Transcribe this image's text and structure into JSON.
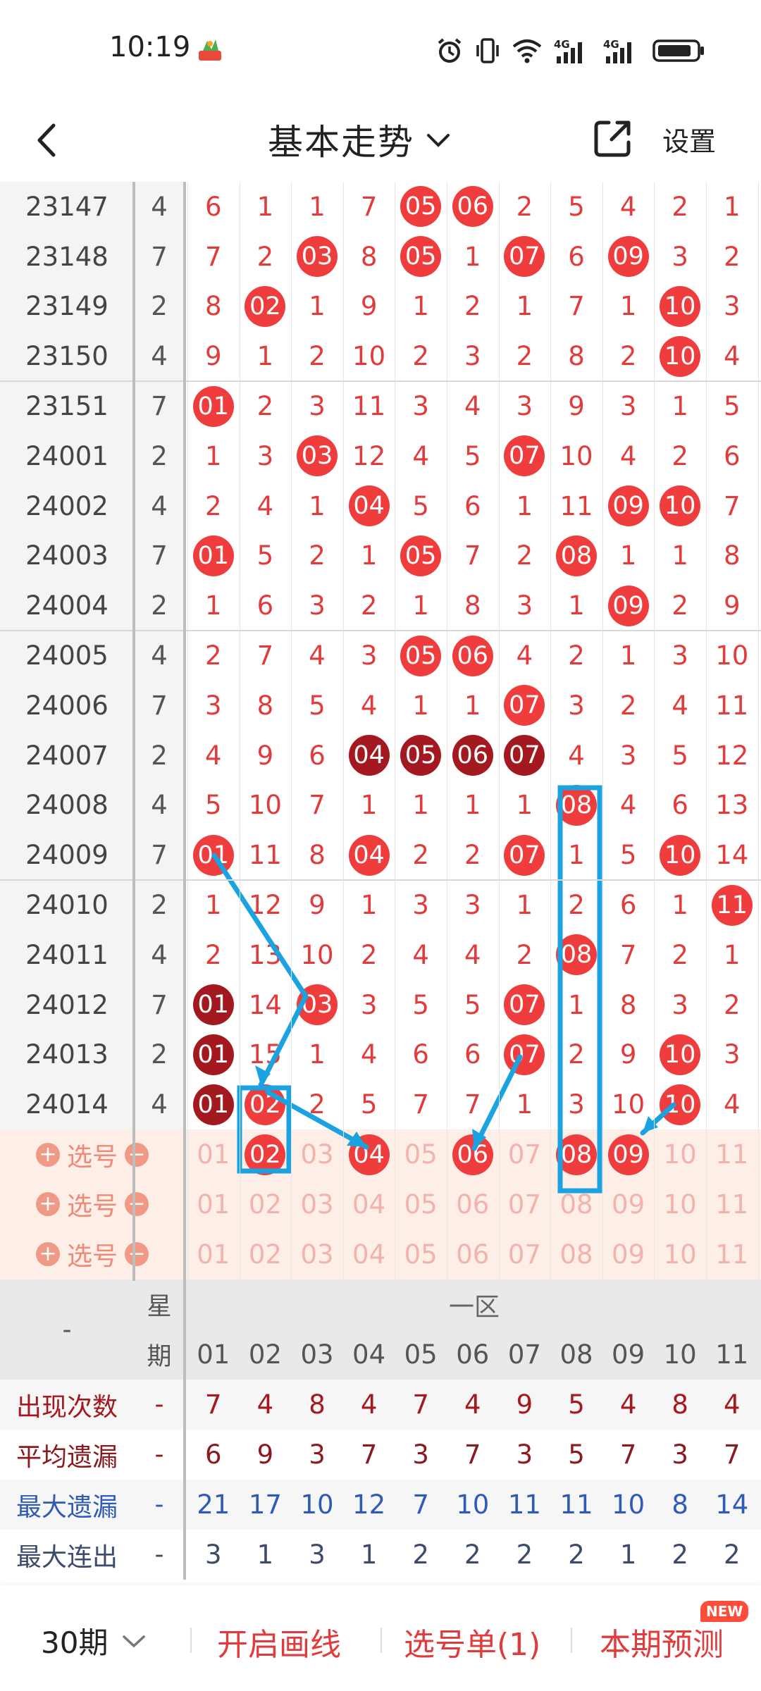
{
  "status_bar": {
    "time": "10:19",
    "net1": "4G",
    "net2": "4G"
  },
  "header": {
    "title": "基本走势",
    "settings": "设置"
  },
  "columns": [
    "01",
    "02",
    "03",
    "04",
    "05",
    "06",
    "07",
    "08",
    "09",
    "10",
    "11"
  ],
  "rows": [
    {
      "issue": "23147",
      "week": "4",
      "cells": [
        "6",
        "1",
        "1",
        "7",
        "05",
        "06",
        "2",
        "5",
        "4",
        "2",
        "1"
      ],
      "balls": [
        4,
        5
      ],
      "dark": []
    },
    {
      "issue": "23148",
      "week": "7",
      "cells": [
        "7",
        "2",
        "03",
        "8",
        "05",
        "1",
        "07",
        "6",
        "09",
        "3",
        "2"
      ],
      "balls": [
        2,
        4,
        6,
        8
      ],
      "dark": []
    },
    {
      "issue": "23149",
      "week": "2",
      "cells": [
        "8",
        "02",
        "1",
        "9",
        "1",
        "2",
        "1",
        "7",
        "1",
        "10",
        "3"
      ],
      "balls": [
        1,
        9
      ],
      "dark": []
    },
    {
      "issue": "23150",
      "week": "4",
      "cells": [
        "9",
        "1",
        "2",
        "10",
        "2",
        "3",
        "2",
        "8",
        "2",
        "10",
        "4"
      ],
      "balls": [
        9
      ],
      "dark": []
    },
    {
      "issue": "23151",
      "week": "7",
      "cells": [
        "01",
        "2",
        "3",
        "11",
        "3",
        "4",
        "3",
        "9",
        "3",
        "1",
        "5"
      ],
      "balls": [
        0
      ],
      "dark": []
    },
    {
      "issue": "24001",
      "week": "2",
      "cells": [
        "1",
        "3",
        "03",
        "12",
        "4",
        "5",
        "07",
        "10",
        "4",
        "2",
        "6"
      ],
      "balls": [
        2,
        6
      ],
      "dark": []
    },
    {
      "issue": "24002",
      "week": "4",
      "cells": [
        "2",
        "4",
        "1",
        "04",
        "5",
        "6",
        "1",
        "11",
        "09",
        "10",
        "7"
      ],
      "balls": [
        3,
        8,
        9
      ],
      "dark": []
    },
    {
      "issue": "24003",
      "week": "7",
      "cells": [
        "01",
        "5",
        "2",
        "1",
        "05",
        "7",
        "2",
        "08",
        "1",
        "1",
        "8"
      ],
      "balls": [
        0,
        4,
        7
      ],
      "dark": []
    },
    {
      "issue": "24004",
      "week": "2",
      "cells": [
        "1",
        "6",
        "3",
        "2",
        "1",
        "8",
        "3",
        "1",
        "09",
        "2",
        "9"
      ],
      "balls": [
        8
      ],
      "dark": []
    },
    {
      "issue": "24005",
      "week": "4",
      "cells": [
        "2",
        "7",
        "4",
        "3",
        "05",
        "06",
        "4",
        "2",
        "1",
        "3",
        "10"
      ],
      "balls": [
        4,
        5
      ],
      "dark": []
    },
    {
      "issue": "24006",
      "week": "7",
      "cells": [
        "3",
        "8",
        "5",
        "4",
        "1",
        "1",
        "07",
        "3",
        "2",
        "4",
        "11"
      ],
      "balls": [
        6
      ],
      "dark": []
    },
    {
      "issue": "24007",
      "week": "2",
      "cells": [
        "4",
        "9",
        "6",
        "04",
        "05",
        "06",
        "07",
        "4",
        "3",
        "5",
        "12"
      ],
      "balls": [
        3,
        4,
        5,
        6
      ],
      "dark": [
        3,
        4,
        5,
        6
      ]
    },
    {
      "issue": "24008",
      "week": "4",
      "cells": [
        "5",
        "10",
        "7",
        "1",
        "1",
        "1",
        "1",
        "08",
        "4",
        "6",
        "13"
      ],
      "balls": [
        7
      ],
      "dark": []
    },
    {
      "issue": "24009",
      "week": "7",
      "cells": [
        "01",
        "11",
        "8",
        "04",
        "2",
        "2",
        "07",
        "1",
        "5",
        "10",
        "14"
      ],
      "balls": [
        0,
        3,
        6,
        9
      ],
      "dark": []
    },
    {
      "issue": "24010",
      "week": "2",
      "cells": [
        "1",
        "12",
        "9",
        "1",
        "3",
        "3",
        "1",
        "2",
        "6",
        "1",
        "11"
      ],
      "balls": [
        10
      ],
      "dark": []
    },
    {
      "issue": "24011",
      "week": "4",
      "cells": [
        "2",
        "13",
        "10",
        "2",
        "4",
        "4",
        "2",
        "08",
        "7",
        "2",
        "1"
      ],
      "balls": [
        7
      ],
      "dark": []
    },
    {
      "issue": "24012",
      "week": "7",
      "cells": [
        "01",
        "14",
        "03",
        "3",
        "5",
        "5",
        "07",
        "1",
        "8",
        "3",
        "2"
      ],
      "balls": [
        0,
        2,
        6
      ],
      "dark": [
        0
      ]
    },
    {
      "issue": "24013",
      "week": "2",
      "cells": [
        "01",
        "15",
        "1",
        "4",
        "6",
        "6",
        "07",
        "2",
        "9",
        "10",
        "3"
      ],
      "balls": [
        0,
        6,
        9
      ],
      "dark": [
        0
      ]
    },
    {
      "issue": "24014",
      "week": "4",
      "cells": [
        "01",
        "02",
        "2",
        "5",
        "7",
        "7",
        "1",
        "3",
        "10",
        "10",
        "4"
      ],
      "balls": [
        0,
        1,
        9
      ],
      "dark": [
        0
      ]
    }
  ],
  "pick_label": "选号",
  "pick_rows": [
    {
      "balls": [
        1,
        3,
        5,
        7,
        8
      ]
    },
    {
      "balls": []
    },
    {
      "balls": []
    }
  ],
  "stats": {
    "dash": "-",
    "week_head": [
      "星",
      "期"
    ],
    "zone": "一区",
    "rows": [
      {
        "label": "出现次数",
        "week": "-",
        "values": [
          "7",
          "4",
          "8",
          "4",
          "7",
          "4",
          "9",
          "5",
          "4",
          "8",
          "4"
        ],
        "color": "#a3191f"
      },
      {
        "label": "平均遗漏",
        "week": "-",
        "values": [
          "6",
          "9",
          "3",
          "7",
          "3",
          "7",
          "3",
          "5",
          "7",
          "3",
          "7"
        ],
        "color": "#8a1a1e"
      },
      {
        "label": "最大遗漏",
        "week": "-",
        "values": [
          "21",
          "17",
          "10",
          "12",
          "7",
          "10",
          "11",
          "11",
          "10",
          "8",
          "14"
        ],
        "color": "#2f5bb7"
      },
      {
        "label": "最大连出",
        "week": "-",
        "values": [
          "3",
          "1",
          "3",
          "1",
          "2",
          "2",
          "2",
          "2",
          "1",
          "2",
          "2"
        ],
        "color": "#3c4a6b"
      }
    ]
  },
  "bottom_bar": {
    "period": "30期",
    "draw_line": "开启画线",
    "pick_list": "选号单(1)",
    "predict": "本期预测",
    "new_badge": "NEW"
  }
}
